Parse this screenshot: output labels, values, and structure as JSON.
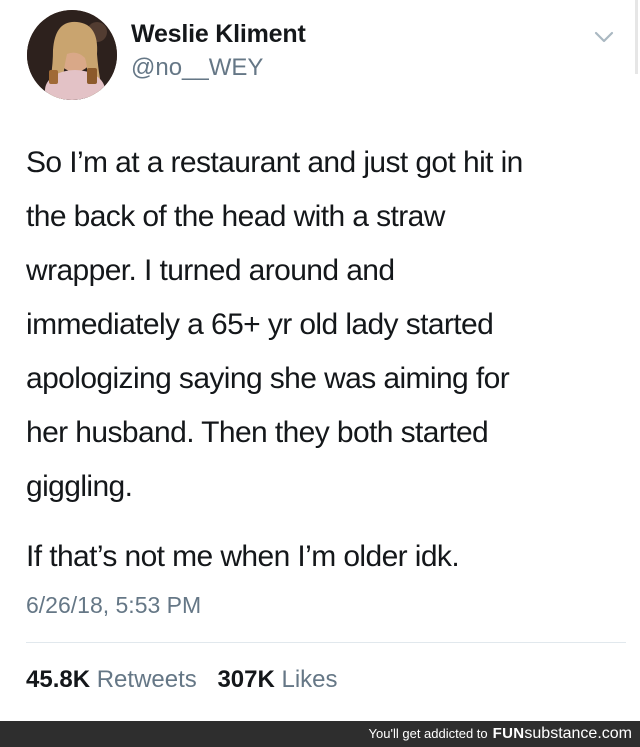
{
  "user": {
    "display_name": "Weslie Kliment",
    "handle": "@no__WEY",
    "avatar_icon": "profile-photo"
  },
  "tweet": {
    "text": "So I’m at a restaurant and just got hit in\nthe back of the head with a straw\nwrapper. I turned around and\nimmediately a 65+ yr old lady started\napologizing saying she was aiming for\nher husband. Then they both started\ngiggling.",
    "text_2": "If that’s not me when I’m older idk.",
    "timestamp": "6/26/18, 5:53 PM"
  },
  "stats": {
    "retweets_count": "45.8K",
    "retweets_label": "Retweets",
    "likes_count": "307K",
    "likes_label": "Likes"
  },
  "footer": {
    "prefix": "You'll get addicted to",
    "brand_a": "FUN",
    "brand_b": "substance.com"
  },
  "colors": {
    "text": "#14171a",
    "secondary": "#657786",
    "divider": "#e1e8ed",
    "footer_bg": "#2e2e2e"
  }
}
